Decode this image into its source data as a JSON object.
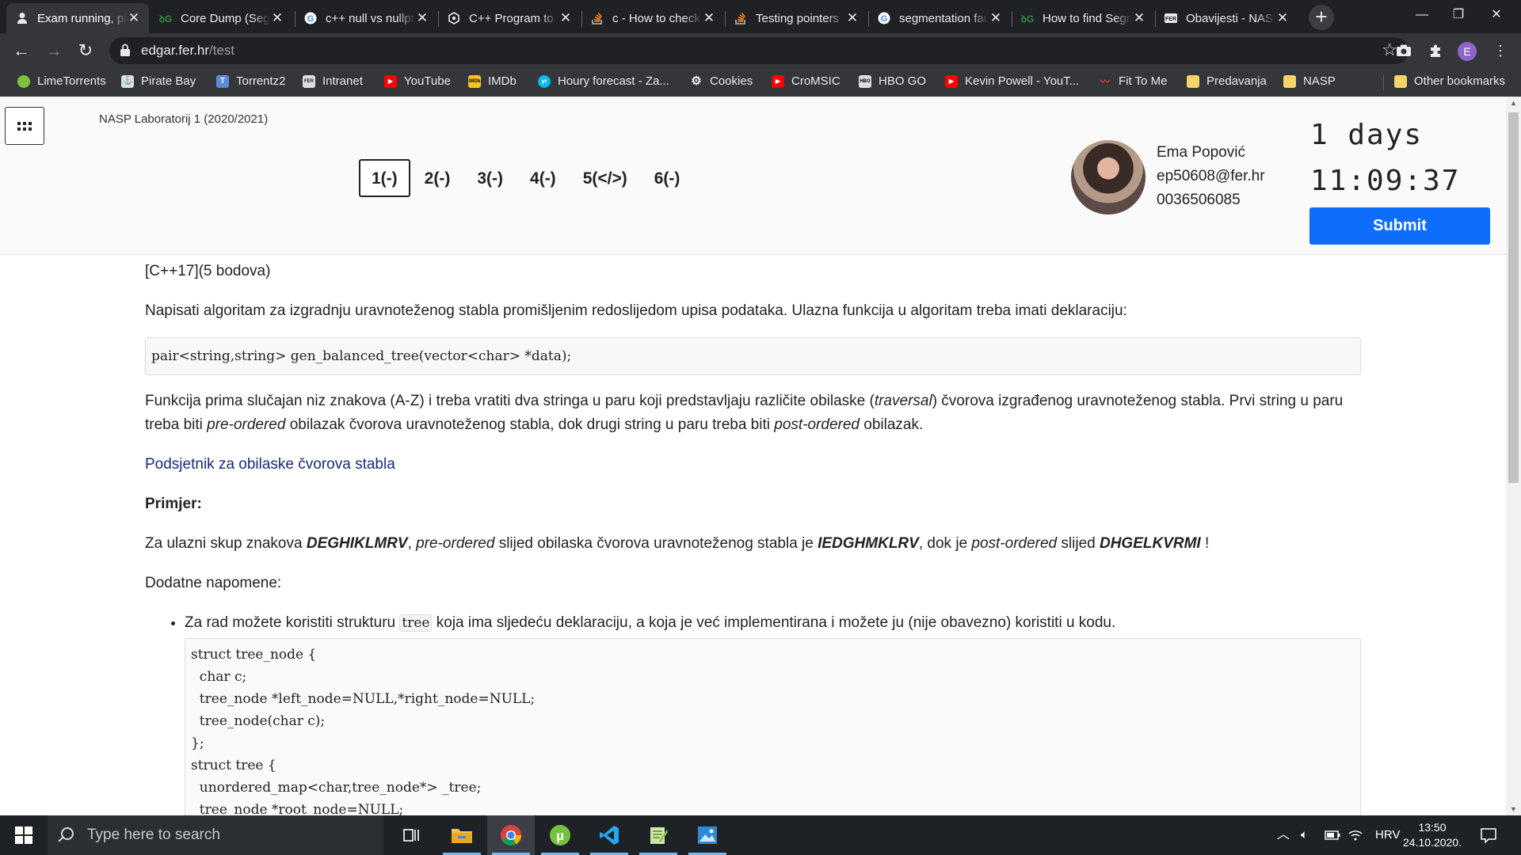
{
  "browser": {
    "tabs": [
      {
        "title": "Exam running, please",
        "favicon": "person-icon",
        "active": true
      },
      {
        "title": "Core Dump (Segmentation",
        "favicon": "gfg-icon",
        "active": false
      },
      {
        "title": "c++ null vs nullptr",
        "favicon": "google-icon",
        "active": false
      },
      {
        "title": "C++ Program to",
        "favicon": "openai-icon",
        "active": false
      },
      {
        "title": "c - How to check",
        "favicon": "stackoverflow-icon",
        "active": false
      },
      {
        "title": "Testing pointers",
        "favicon": "stackoverflow-icon",
        "active": false
      },
      {
        "title": "segmentation fault",
        "favicon": "google-icon",
        "active": false
      },
      {
        "title": "How to find Segmentation",
        "favicon": "gfg-icon",
        "active": false
      },
      {
        "title": "Obavijesti - NASP",
        "favicon": "fer-icon",
        "active": false
      }
    ],
    "url_host": "edgar.fer.hr",
    "url_path": "/test",
    "profile_initial": "E",
    "bookmarks": [
      {
        "label": "LimeTorrents",
        "icon": "lime-icon",
        "color": "#7cc142"
      },
      {
        "label": "Pirate Bay",
        "icon": "pirate-icon",
        "color": "#dddddd"
      },
      {
        "label": "Torrentz2",
        "icon": "torrentz-icon",
        "color": "#5b8dd6"
      },
      {
        "label": "Intranet",
        "icon": "fer-icon",
        "color": "#dddddd"
      },
      {
        "label": "YouTube",
        "icon": "youtube-icon",
        "color": "#ff0000"
      },
      {
        "label": "IMDb",
        "icon": "imdb-icon",
        "color": "#f5c518"
      },
      {
        "label": "Houry forecast - Za...",
        "icon": "yr-icon",
        "color": "#00b8f1"
      },
      {
        "label": "Cookies",
        "icon": "gear-icon",
        "color": "#dddddd"
      },
      {
        "label": "CroMSIC",
        "icon": "youtube-icon",
        "color": "#ff0000"
      },
      {
        "label": "HBO GO",
        "icon": "hbo-icon",
        "color": "#dddddd"
      },
      {
        "label": "Kevin Powell - YouT...",
        "icon": "youtube-icon",
        "color": "#ff0000"
      },
      {
        "label": "Fit To Me",
        "icon": "fittome-icon",
        "color": "#e53935"
      },
      {
        "label": "Predavanja",
        "icon": "folder-icon",
        "color": "#f6d36b"
      },
      {
        "label": "NASP",
        "icon": "folder-icon",
        "color": "#f6d36b"
      }
    ],
    "other_bookmarks": "Other bookmarks"
  },
  "header": {
    "course": "NASP Laboratorij 1 (2020/2021)",
    "questions": [
      "1(-)",
      "2(-)",
      "3(-)",
      "4(-)",
      "5(</>)",
      "6(-)"
    ],
    "current_question": 0,
    "user_name": "Ema Popović",
    "user_email": "ep50608@fer.hr",
    "user_jmbag": "0036506085",
    "timer_days": "1 days",
    "timer_clock": "11:09:37",
    "submit_label": "Submit"
  },
  "question": {
    "meta": "[C++17](5 bodova)",
    "intro": "Napisati algoritam za izgradnju uravnoteženog stabla promišljenim redoslijedom upisa podataka. Ulazna funkcija u algoritam treba imati deklaraciju:",
    "signature": "pair<string,string> gen_balanced_tree(vector<char> *data);",
    "desc_1": "Funkcija prima slučajan niz znakova (A-Z) i treba vratiti dva stringa u paru koji predstavljaju različite obilaske (",
    "desc_traversal": "traversal",
    "desc_2": ") čvorova izgrađenog uravnoteženog stabla. Prvi string u paru treba biti ",
    "desc_pre": "pre-ordered",
    "desc_3": " obilazak čvorova uravnoteženog stabla, dok drugi string u paru treba biti ",
    "desc_post": "post-ordered",
    "desc_4": " obilazak.",
    "reminder_link": "Podsjetnik za obilaske čvorova stabla",
    "example_heading": "Primjer:",
    "ex_1": "Za ulazni skup znakova ",
    "ex_input": "DEGHIKLMRV",
    "ex_2": ", ",
    "ex_pre": "pre-ordered",
    "ex_3": " slijed obilaska čvorova uravnoteženog stabla je ",
    "ex_pre_result": "IEDGHMKLRV",
    "ex_4": ", dok je ",
    "ex_post": "post-ordered",
    "ex_5": " slijed ",
    "ex_post_result": "DHGELKVRMI",
    "ex_6": " !",
    "notes_heading": "Dodatne napomene:",
    "note1_a": "Za rad možete koristiti strukturu ",
    "note1_code": "tree",
    "note1_b": " koja ima sljedeću deklaraciju, a koja je već implementirana i možete ju (nije obavezno) koristiti u kodu.",
    "struct_code": "struct tree_node {\n  char c;\n  tree_node *left_node=NULL,*right_node=NULL;\n  tree_node(char c);\n};\nstruct tree {\n  unordered_map<char,tree_node*> _tree;\n  tree_node *root_node=NULL;"
  },
  "taskbar": {
    "search_placeholder": "Type here to search",
    "language": "HRV",
    "time": "13:50",
    "date": "24.10.2020."
  }
}
